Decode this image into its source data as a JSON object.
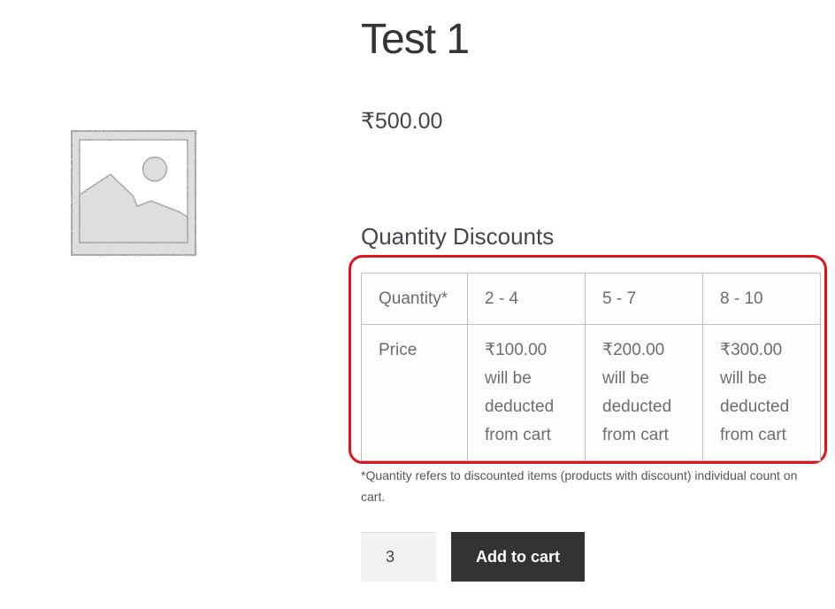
{
  "product": {
    "image_icon": "image-placeholder-icon",
    "title": "Test 1",
    "price": "₹500.00"
  },
  "discounts": {
    "heading": "Quantity Discounts",
    "header_row": {
      "label": "Quantity*",
      "cells": [
        "2 - 4",
        "5 - 7",
        "8 - 10"
      ]
    },
    "price_row": {
      "label": "Price",
      "cells": [
        [
          "₹100.00",
          "will be",
          "deducted",
          "from cart"
        ],
        [
          "₹200.00",
          "will be",
          "deducted",
          "from cart"
        ],
        [
          "₹300.00",
          "will be",
          "deducted",
          "from cart"
        ]
      ]
    },
    "highlight_color": "#e0141e",
    "footnote": "*Quantity refers to discounted items (products with discount) individual count on cart."
  },
  "cart": {
    "quantity_value": "3",
    "add_to_cart_label": "Add to cart",
    "button_color": "#333333"
  }
}
